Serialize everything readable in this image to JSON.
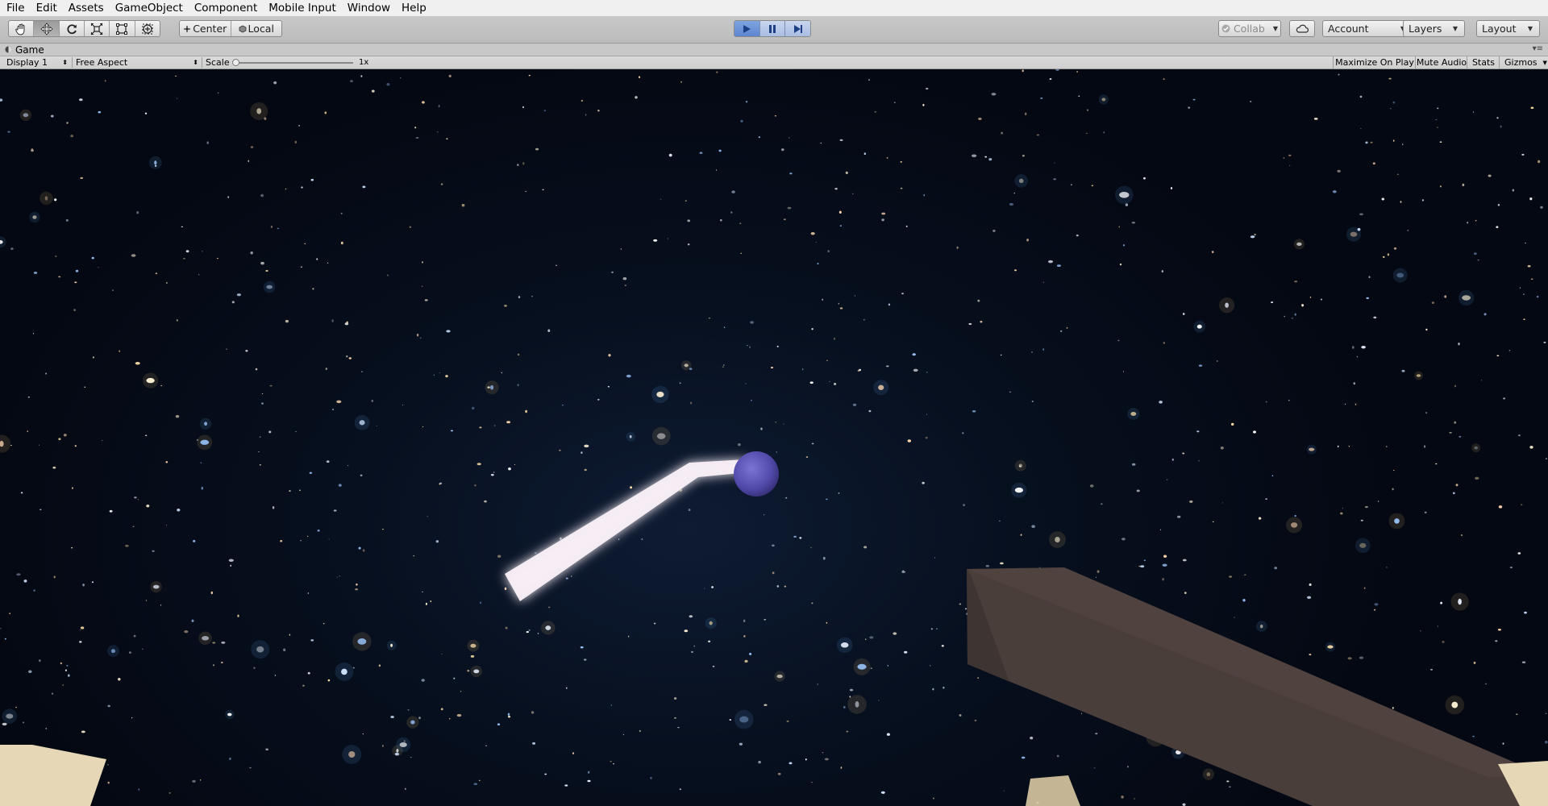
{
  "menu": {
    "items": [
      "File",
      "Edit",
      "Assets",
      "GameObject",
      "Component",
      "Mobile Input",
      "Window",
      "Help"
    ]
  },
  "toolbar": {
    "tools": [
      {
        "icon": "hand-icon",
        "active": false
      },
      {
        "icon": "move-icon",
        "active": true
      },
      {
        "icon": "rotate-icon",
        "active": false
      },
      {
        "icon": "scale-icon",
        "active": false
      },
      {
        "icon": "rect-tool-icon",
        "active": false
      },
      {
        "icon": "transform-tool-icon",
        "active": false
      }
    ],
    "pivot_label": "Center",
    "rotation_label": "Local",
    "play": {
      "playing": true,
      "paused": false
    },
    "collab_label": "Collab",
    "account_label": "Account",
    "layers_label": "Layers",
    "layout_label": "Layout"
  },
  "game_view": {
    "tab_label": "Game",
    "display_label": "Display 1",
    "aspect_label": "Free Aspect",
    "scale_label": "Scale",
    "scale_value": "1x",
    "maximize_label": "Maximize On Play",
    "mute_label": "Mute Audio",
    "stats_label": "Stats",
    "gizmos_label": "Gizmos"
  },
  "scene": {
    "objects": [
      "starfield-background",
      "white-beam",
      "purple-sphere",
      "brown-block",
      "tan-block-left",
      "tan-block-right"
    ],
    "colors": {
      "space": "#050a16",
      "beam": "#f6eef4",
      "sphere": "#5c56b8",
      "block": "#4a3e3b",
      "tan": "#e6d8b6"
    }
  }
}
